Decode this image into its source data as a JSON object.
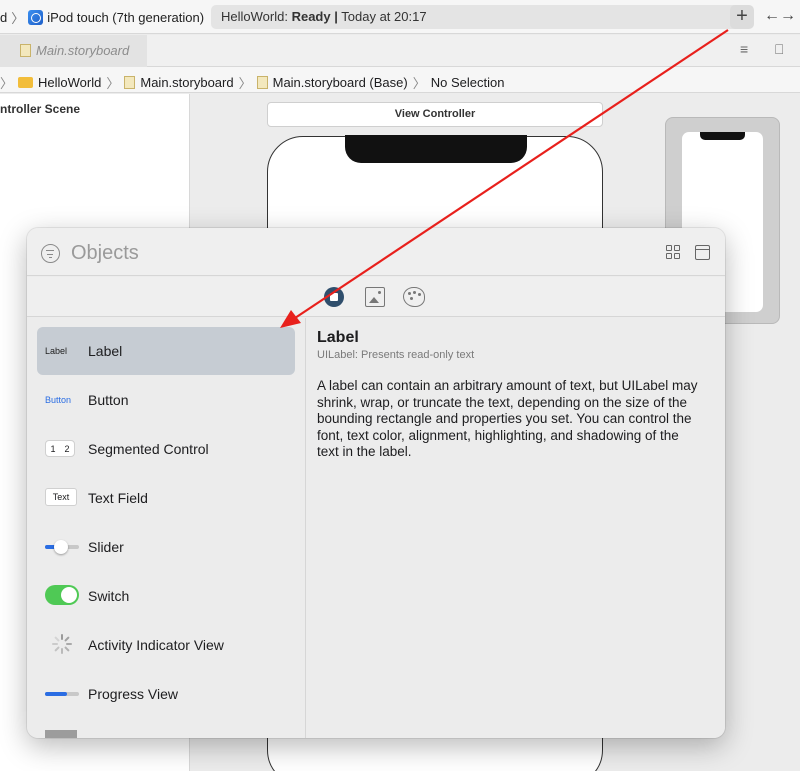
{
  "toolbar": {
    "scheme_prefix": "d",
    "destination": "iPod touch (7th generation)",
    "status_app": "HelloWorld:",
    "status_state": "Ready",
    "status_separator": "|",
    "status_time": "Today at 20:17",
    "add_label": "+",
    "swap_label": "←→"
  },
  "tabs": {
    "active_tab": "Main.storyboard",
    "editor_options_icon": "≡",
    "add_editor_icon": "⎕"
  },
  "breadcrumb": {
    "items": [
      "HelloWorld",
      "Main.storyboard",
      "Main.storyboard (Base)",
      "No Selection"
    ],
    "separator": "〉"
  },
  "outline": {
    "title": "ntroller Scene"
  },
  "canvas": {
    "scene_header": "View Controller"
  },
  "library": {
    "search_placeholder": "Objects",
    "tabs": [
      "objects-icon",
      "media-icon",
      "colors-icon"
    ],
    "items": [
      {
        "thumb": "Label",
        "label": "Label"
      },
      {
        "thumb": "Button",
        "label": "Button"
      },
      {
        "thumb_left": "1",
        "thumb_right": "2",
        "label": "Segmented Control"
      },
      {
        "thumb": "Text",
        "label": "Text Field"
      },
      {
        "label": "Slider"
      },
      {
        "label": "Switch"
      },
      {
        "label": "Activity Indicator View"
      },
      {
        "label": "Progress View"
      }
    ],
    "selected_index": 0,
    "detail": {
      "title": "Label",
      "subtitle": "UILabel: Presents read-only text",
      "description": "A label can contain an arbitrary amount of text, but UILabel may shrink, wrap, or truncate the text, depending on the size of the bounding rectangle and properties you set. You can control the font, text color, alignment, highlighting, and shadowing of the text in the label."
    }
  },
  "colors": {
    "selection": "#c6ccd3",
    "accent_blue": "#2a6de3",
    "switch_green": "#4fc955",
    "annotation_arrow": "#e8201c"
  }
}
